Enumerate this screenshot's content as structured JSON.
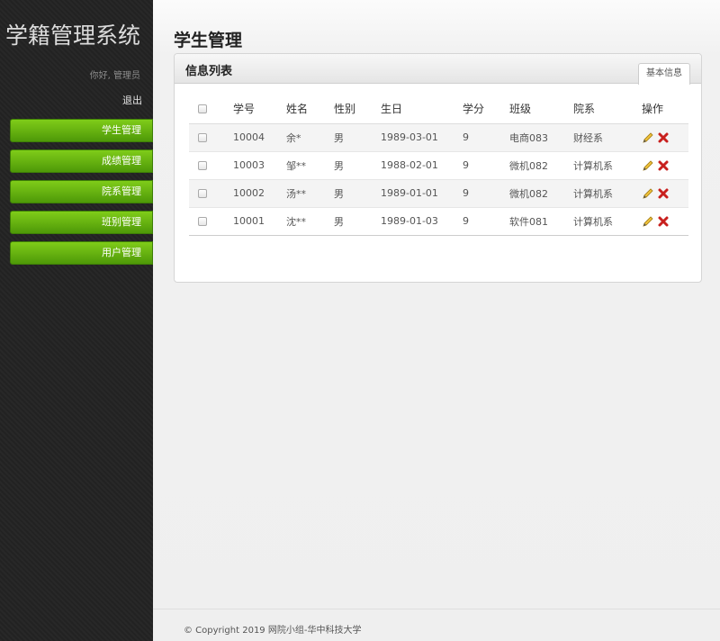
{
  "app": {
    "title": "学籍管理系统"
  },
  "sidebar": {
    "greeting": "你好, 管理员",
    "logout": "退出",
    "items": [
      {
        "label": "学生管理"
      },
      {
        "label": "成绩管理"
      },
      {
        "label": "院系管理"
      },
      {
        "label": "班别管理"
      },
      {
        "label": "用户管理"
      }
    ]
  },
  "main": {
    "page_title": "学生管理",
    "panel_title": "信息列表",
    "tab_label": "基本信息"
  },
  "table": {
    "headers": [
      "学号",
      "姓名",
      "性别",
      "生日",
      "学分",
      "班级",
      "院系",
      "操作"
    ],
    "rows": [
      {
        "id": "10004",
        "name": "余*",
        "sex": "男",
        "birthday": "1989-03-01",
        "credit": "9",
        "class": "电商083",
        "dept": "财经系"
      },
      {
        "id": "10003",
        "name": "邹**",
        "sex": "男",
        "birthday": "1988-02-01",
        "credit": "9",
        "class": "微机082",
        "dept": "计算机系"
      },
      {
        "id": "10002",
        "name": "汤**",
        "sex": "男",
        "birthday": "1989-01-01",
        "credit": "9",
        "class": "微机082",
        "dept": "计算机系"
      },
      {
        "id": "10001",
        "name": "沈**",
        "sex": "男",
        "birthday": "1989-01-03",
        "credit": "9",
        "class": "软件081",
        "dept": "计算机系"
      }
    ]
  },
  "icons": {
    "edit": "pencil-icon",
    "delete": "delete-x-icon"
  },
  "colors": {
    "accent": "#5ea514",
    "delete": "#c8201e",
    "sidebar_bg": "#232323"
  },
  "footer": {
    "copyright": "© Copyright 2019 网院小组-华中科技大学"
  }
}
